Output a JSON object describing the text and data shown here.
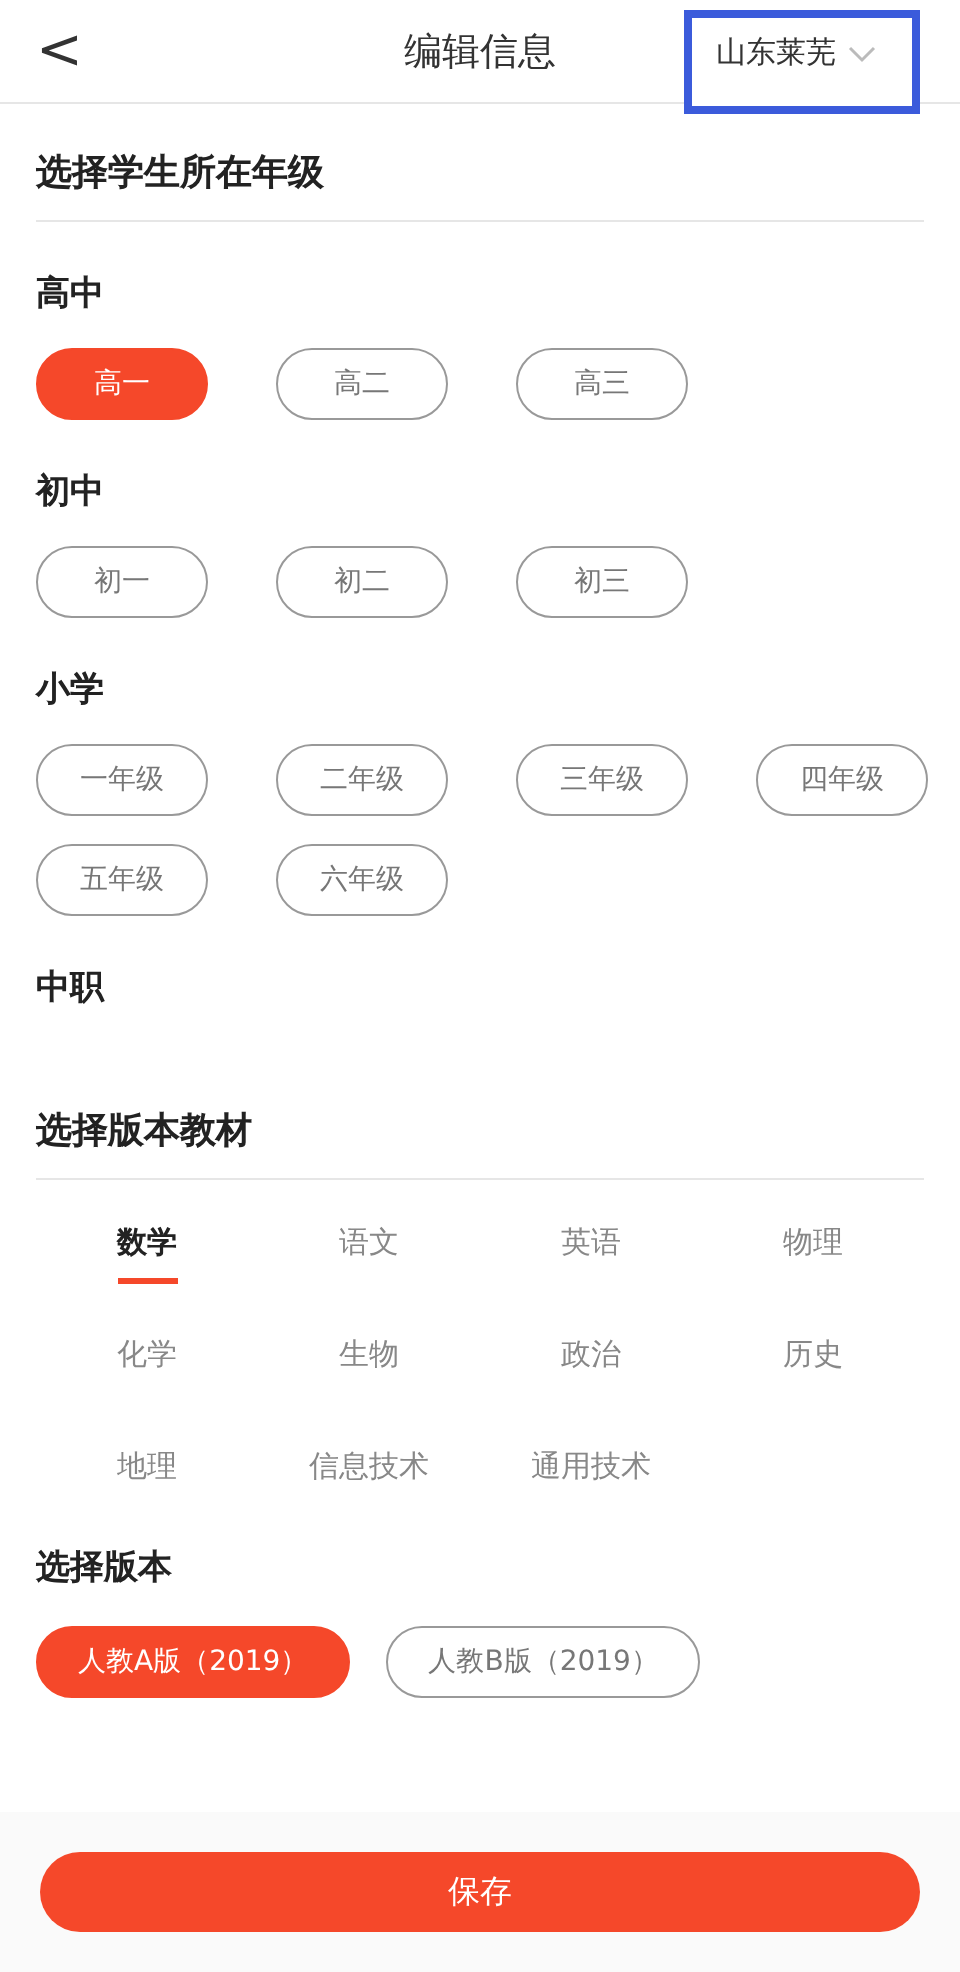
{
  "header": {
    "back": "<",
    "title": "编辑信息",
    "region": "山东莱芜",
    "region_highlighted": true
  },
  "grade_section": {
    "title": "选择学生所在年级",
    "groups": [
      {
        "name": "高中",
        "grades": [
          {
            "label": "高一",
            "selected": true
          },
          {
            "label": "高二",
            "selected": false
          },
          {
            "label": "高三",
            "selected": false
          }
        ]
      },
      {
        "name": "初中",
        "grades": [
          {
            "label": "初一",
            "selected": false
          },
          {
            "label": "初二",
            "selected": false
          },
          {
            "label": "初三",
            "selected": false
          }
        ]
      },
      {
        "name": "小学",
        "grades": [
          {
            "label": "一年级",
            "selected": false
          },
          {
            "label": "二年级",
            "selected": false
          },
          {
            "label": "三年级",
            "selected": false
          },
          {
            "label": "四年级",
            "selected": false
          },
          {
            "label": "五年级",
            "selected": false
          },
          {
            "label": "六年级",
            "selected": false
          }
        ]
      },
      {
        "name": "中职"
      }
    ]
  },
  "subject_section": {
    "title": "选择版本教材",
    "subjects": [
      {
        "label": "数学",
        "selected": true
      },
      {
        "label": "语文",
        "selected": false
      },
      {
        "label": "英语",
        "selected": false
      },
      {
        "label": "物理",
        "selected": false
      },
      {
        "label": "化学",
        "selected": false
      },
      {
        "label": "生物",
        "selected": false
      },
      {
        "label": "政治",
        "selected": false
      },
      {
        "label": "历史",
        "selected": false
      },
      {
        "label": "地理",
        "selected": false
      },
      {
        "label": "信息技术",
        "selected": false
      },
      {
        "label": "通用技术",
        "selected": false
      }
    ]
  },
  "version_section": {
    "title": "选择版本",
    "versions": [
      {
        "label": "人教A版（2019）",
        "selected": true
      },
      {
        "label": "人教B版（2019）",
        "selected": false
      }
    ]
  },
  "save_button": "保存"
}
